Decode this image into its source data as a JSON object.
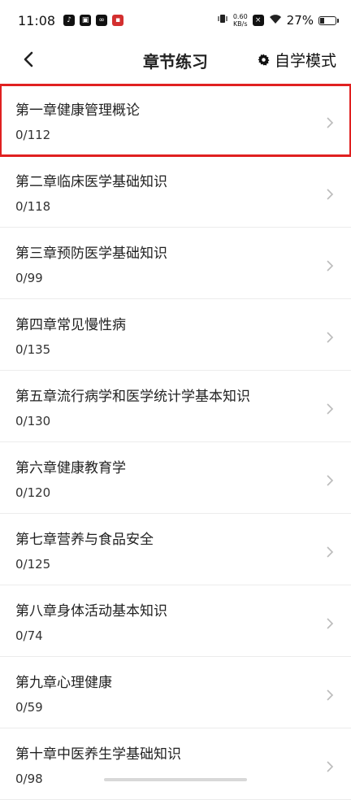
{
  "status": {
    "time": "11:08",
    "net_speed": "0.60",
    "net_unit": "KB/s",
    "battery": "27%"
  },
  "nav": {
    "title": "章节练习",
    "mode_label": "自学模式"
  },
  "chapters": [
    {
      "name": "第一章健康管理概论",
      "count": "0/112"
    },
    {
      "name": "第二章临床医学基础知识",
      "count": "0/118"
    },
    {
      "name": "第三章预防医学基础知识",
      "count": "0/99"
    },
    {
      "name": "第四章常见慢性病",
      "count": "0/135"
    },
    {
      "name": "第五章流行病学和医学统计学基本知识",
      "count": "0/130"
    },
    {
      "name": "第六章健康教育学",
      "count": "0/120"
    },
    {
      "name": "第七章营养与食品安全",
      "count": "0/125"
    },
    {
      "name": "第八章身体活动基本知识",
      "count": "0/74"
    },
    {
      "name": "第九章心理健康",
      "count": "0/59"
    },
    {
      "name": "第十章中医养生学基础知识",
      "count": "0/98"
    }
  ],
  "highlight_color": "#e02020"
}
